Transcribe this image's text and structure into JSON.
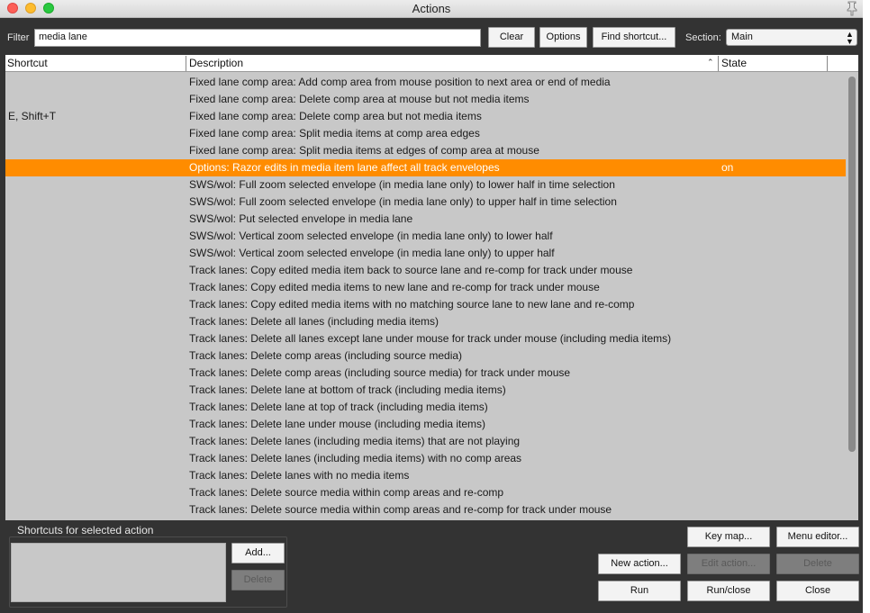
{
  "window": {
    "title": "Actions"
  },
  "filter": {
    "label": "Filter",
    "value": "media lane"
  },
  "toolbar": {
    "clear_label": "Clear",
    "options_label": "Options",
    "find_shortcut_label": "Find shortcut...",
    "section_label": "Section:",
    "section_value": "Main"
  },
  "table": {
    "columns": {
      "shortcut": "Shortcut",
      "description": "Description",
      "state": "State"
    },
    "rows": [
      {
        "shortcut": "",
        "description": "Fixed lane comp area: Add comp area from mouse position to next area or end of media",
        "state": ""
      },
      {
        "shortcut": "",
        "description": "Fixed lane comp area: Delete comp area at mouse but not media items",
        "state": ""
      },
      {
        "shortcut": "E, Shift+T",
        "description": "Fixed lane comp area: Delete comp area but not media items",
        "state": ""
      },
      {
        "shortcut": "",
        "description": "Fixed lane comp area: Split media items at comp area edges",
        "state": ""
      },
      {
        "shortcut": "",
        "description": "Fixed lane comp area: Split media items at edges of comp area at mouse",
        "state": ""
      },
      {
        "shortcut": "",
        "description": "Options: Razor edits in media item lane affect all track envelopes",
        "state": "on",
        "selected": true
      },
      {
        "shortcut": "",
        "description": "SWS/wol: Full zoom selected envelope (in media lane only) to lower half in time selection",
        "state": ""
      },
      {
        "shortcut": "",
        "description": "SWS/wol: Full zoom selected envelope (in media lane only) to upper half in time selection",
        "state": ""
      },
      {
        "shortcut": "",
        "description": "SWS/wol: Put selected envelope in media lane",
        "state": ""
      },
      {
        "shortcut": "",
        "description": "SWS/wol: Vertical zoom selected envelope (in media lane only) to lower half",
        "state": ""
      },
      {
        "shortcut": "",
        "description": "SWS/wol: Vertical zoom selected envelope (in media lane only) to upper half",
        "state": ""
      },
      {
        "shortcut": "",
        "description": "Track lanes: Copy edited media item back to source lane and re-comp for track under mouse",
        "state": ""
      },
      {
        "shortcut": "",
        "description": "Track lanes: Copy edited media items to new lane and re-comp for track under mouse",
        "state": ""
      },
      {
        "shortcut": "",
        "description": "Track lanes: Copy edited media items with no matching source lane to new lane and re-comp",
        "state": ""
      },
      {
        "shortcut": "",
        "description": "Track lanes: Delete all lanes (including media items)",
        "state": ""
      },
      {
        "shortcut": "",
        "description": "Track lanes: Delete all lanes except lane under mouse for track under mouse (including media items)",
        "state": ""
      },
      {
        "shortcut": "",
        "description": "Track lanes: Delete comp areas (including source media)",
        "state": ""
      },
      {
        "shortcut": "",
        "description": "Track lanes: Delete comp areas (including source media) for track under mouse",
        "state": ""
      },
      {
        "shortcut": "",
        "description": "Track lanes: Delete lane at bottom of track (including media items)",
        "state": ""
      },
      {
        "shortcut": "",
        "description": "Track lanes: Delete lane at top of track (including media items)",
        "state": ""
      },
      {
        "shortcut": "",
        "description": "Track lanes: Delete lane under mouse (including media items)",
        "state": ""
      },
      {
        "shortcut": "",
        "description": "Track lanes: Delete lanes (including media items) that are not playing",
        "state": ""
      },
      {
        "shortcut": "",
        "description": "Track lanes: Delete lanes (including media items) with no comp areas",
        "state": ""
      },
      {
        "shortcut": "",
        "description": "Track lanes: Delete lanes with no media items",
        "state": ""
      },
      {
        "shortcut": "",
        "description": "Track lanes: Delete source media within comp areas and re-comp",
        "state": ""
      },
      {
        "shortcut": "",
        "description": "Track lanes: Delete source media within comp areas and re-comp for track under mouse",
        "state": ""
      }
    ]
  },
  "shortcuts_panel": {
    "title": "Shortcuts for selected action",
    "add_label": "Add...",
    "delete_label": "Delete"
  },
  "bottom_buttons": {
    "key_map": "Key map...",
    "menu_editor": "Menu editor...",
    "new_action": "New action...",
    "edit_action": "Edit action...",
    "delete": "Delete",
    "run": "Run",
    "run_close": "Run/close",
    "close": "Close"
  },
  "colors": {
    "selection": "#ff8c00",
    "window_bg": "#333333",
    "list_bg": "#c8c8c8"
  },
  "icons": {
    "pin": "pin-icon",
    "sort": "sort-ascending-icon",
    "select": "chevron-updown-icon"
  }
}
